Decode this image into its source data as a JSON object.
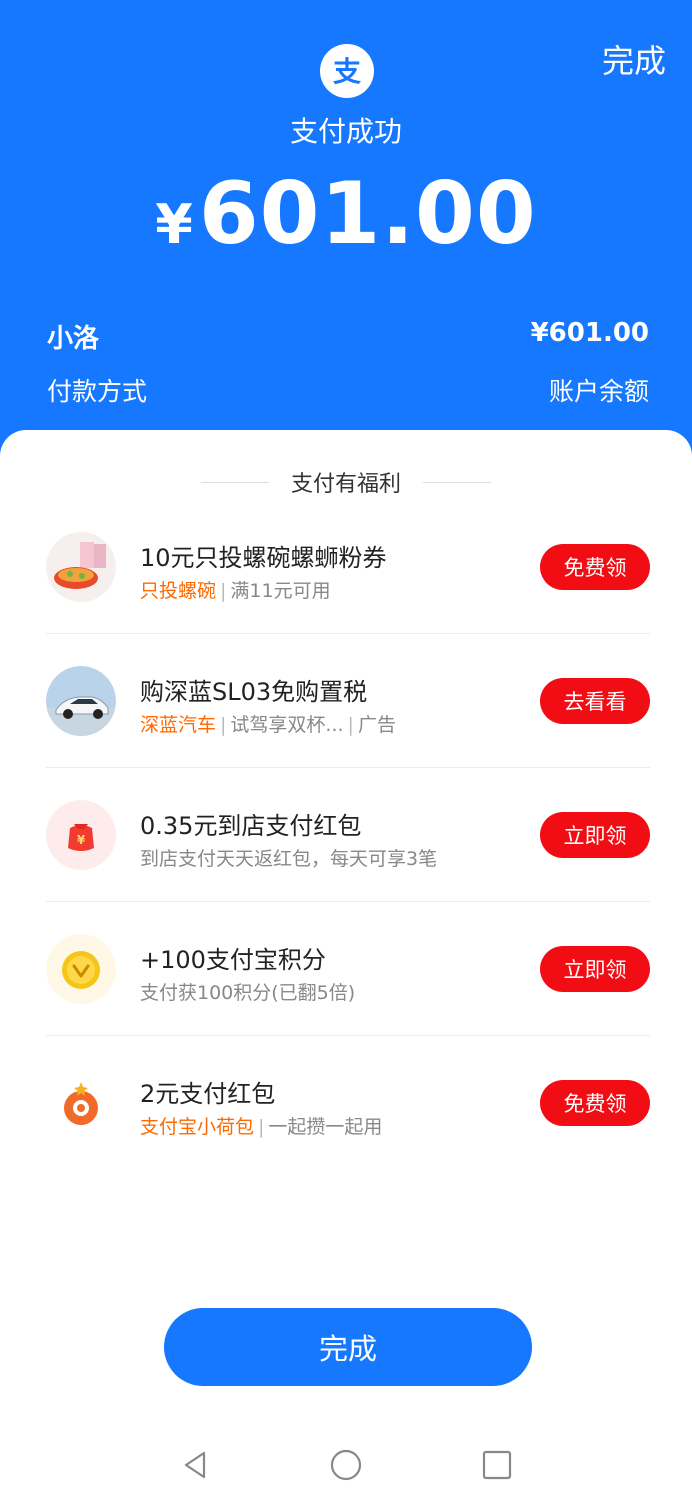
{
  "header": {
    "done_label": "完成",
    "status": "支付成功",
    "currency": "¥",
    "amount": "601.00"
  },
  "details": {
    "payee": "小洛",
    "payee_amount": "¥601.00",
    "method_label": "付款方式",
    "method_value": "账户余额"
  },
  "benefits": {
    "title": "支付有福利",
    "items": [
      {
        "title": "10元只投螺碗螺蛳粉券",
        "brand": "只投螺碗",
        "sub1": "满11元可用",
        "sub2": "",
        "button": "免费领",
        "icon": "snail-noodle-product-icon"
      },
      {
        "title": "购深蓝SL03免购置税",
        "brand": "深蓝汽车",
        "sub1": "试驾享双杯...",
        "sub2": "广告",
        "button": "去看看",
        "icon": "car-icon"
      },
      {
        "title": "0.35元到店支付红包",
        "brand": "",
        "sub1": "到店支付天天返红包，每天可享3笔",
        "sub2": "",
        "button": "立即领",
        "icon": "red-packet-icon"
      },
      {
        "title": "+100支付宝积分",
        "brand": "",
        "sub1": "支付获100积分(已翻5倍)",
        "sub2": "",
        "button": "立即领",
        "icon": "points-coin-icon"
      },
      {
        "title": "2元支付红包",
        "brand": "支付宝小荷包",
        "sub1": "一起攒一起用",
        "sub2": "",
        "button": "免费领",
        "icon": "savings-pouch-icon"
      }
    ]
  },
  "footer": {
    "done_label": "完成"
  },
  "colors": {
    "brand_blue": "#1677ff",
    "button_red": "#f20c14",
    "brand_orange": "#ff6a00"
  }
}
